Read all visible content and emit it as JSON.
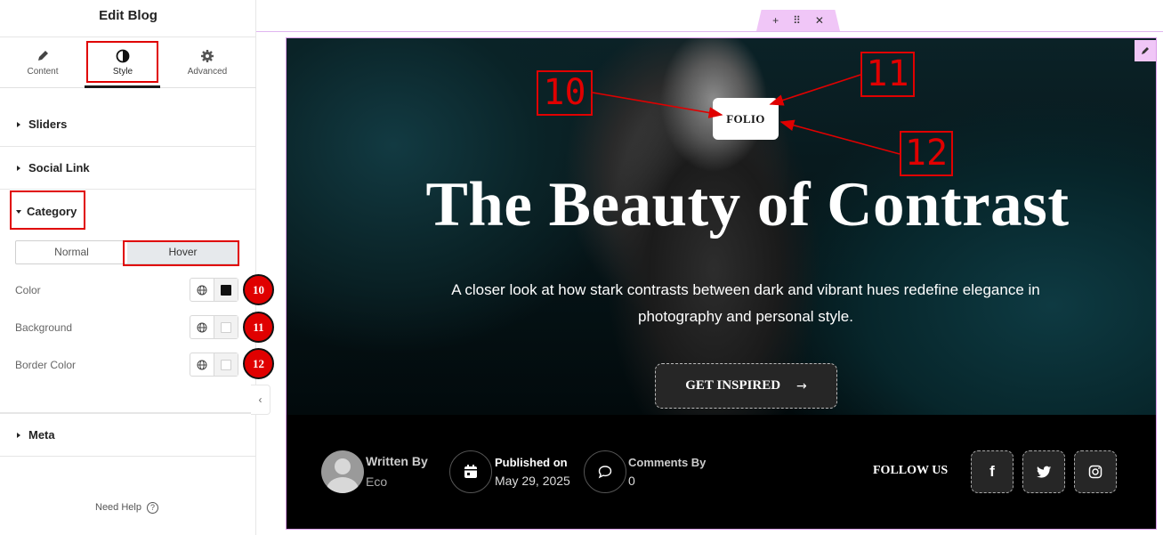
{
  "panel": {
    "title": "Edit Blog",
    "tabs": [
      {
        "label": "Content",
        "icon": "pencil-icon"
      },
      {
        "label": "Style",
        "icon": "contrast-icon"
      },
      {
        "label": "Advanced",
        "icon": "gear-icon"
      }
    ],
    "sections": {
      "sliders": "Sliders",
      "social_link": "Social Link",
      "category": "Category",
      "meta": "Meta"
    },
    "state_tabs": {
      "normal": "Normal",
      "hover": "Hover"
    },
    "controls": [
      {
        "label": "Color",
        "swatch": "#111111",
        "badge": "10"
      },
      {
        "label": "Background",
        "swatch": "#ffffff",
        "badge": "11"
      },
      {
        "label": "Border Color",
        "swatch": "#ffffff",
        "badge": "12"
      }
    ],
    "help": "Need Help",
    "help_icon": "?",
    "collapse_icon": "‹"
  },
  "toolbar": {
    "add": "+",
    "drag": "⠿",
    "close": "✕"
  },
  "hero": {
    "category": "FOLIO",
    "title": "The Beauty of Contrast",
    "subtitle": "A closer look at how stark contrasts between dark and vibrant hues redefine elegance in photography and personal style.",
    "cta": "GET INSPIRED",
    "cta_arrow": "→"
  },
  "meta": {
    "written_by_label": "Written By",
    "author": "Eco",
    "published_label": "Published on",
    "published_date": "May 29, 2025",
    "comments_label": "Comments By",
    "comments_count": "0"
  },
  "follow": {
    "label": "FOLLOW US",
    "icons": [
      "f",
      "twitter-icon",
      "instagram-icon"
    ]
  },
  "callouts": [
    "10",
    "11",
    "12"
  ],
  "colors": {
    "accent": "#e00000",
    "editor_handle": "#f0c6f7"
  }
}
